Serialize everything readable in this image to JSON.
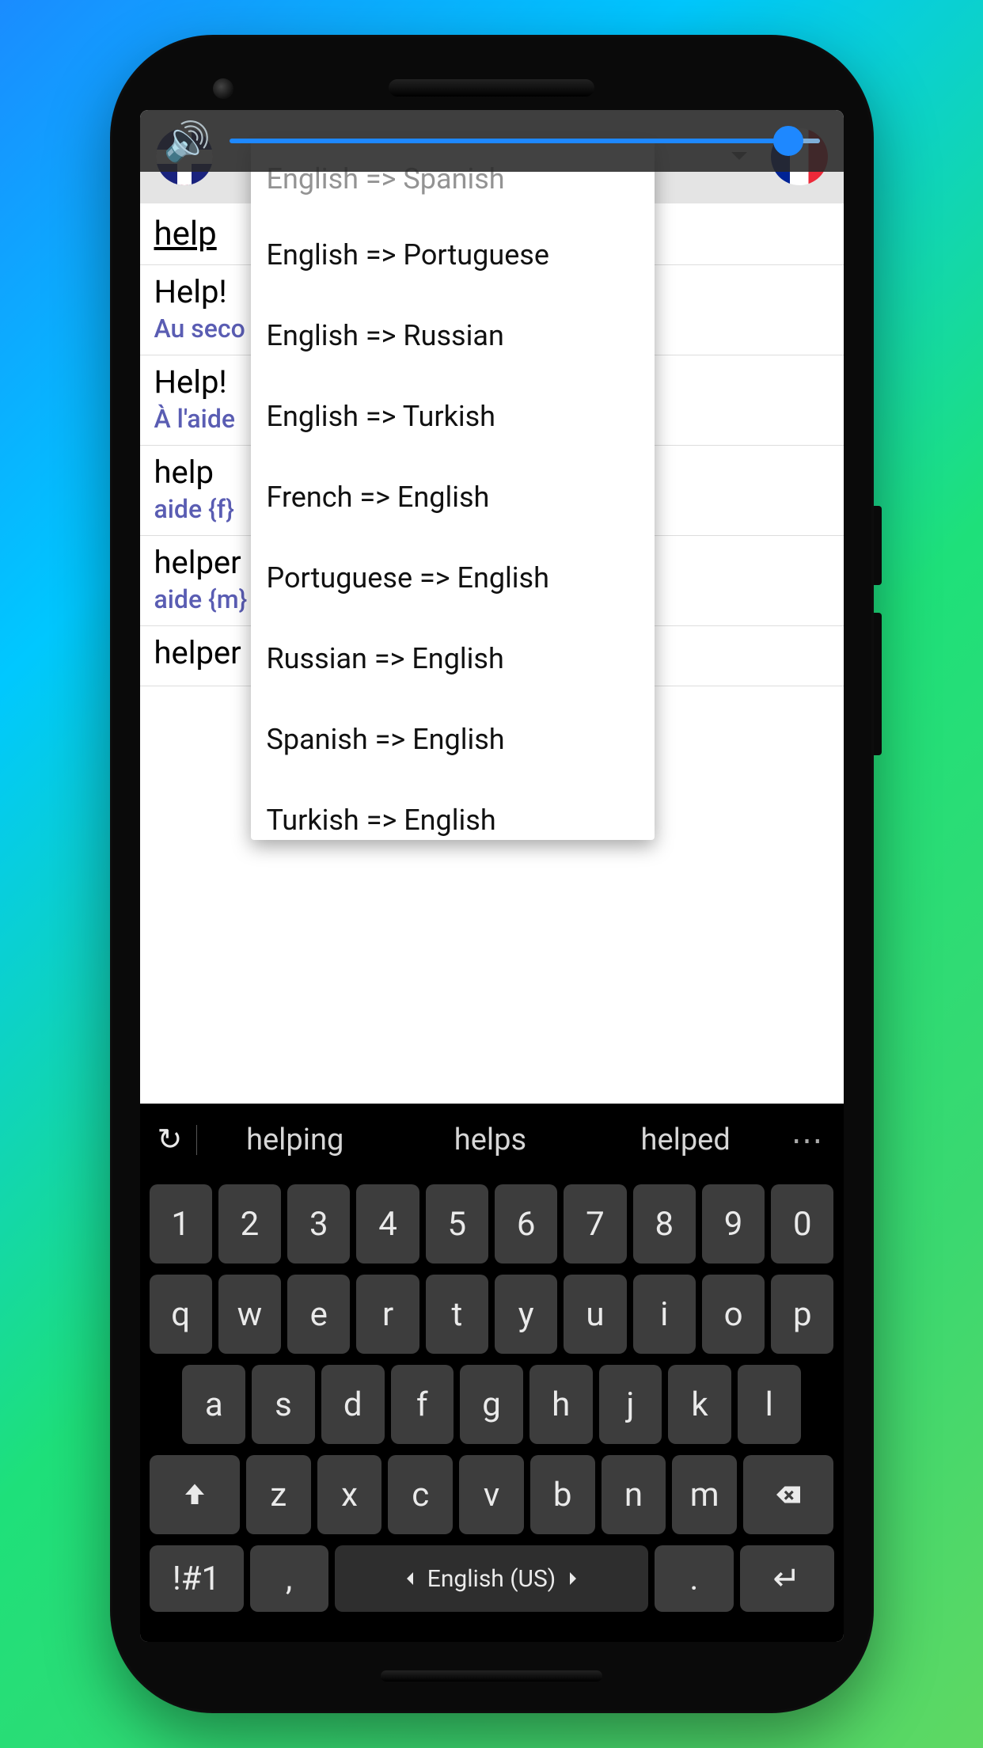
{
  "volume": {
    "icon": "🔊",
    "level_percent": 92
  },
  "header": {
    "source_flag": "uk",
    "target_flag": "fr",
    "selected_pair": "English => Spanish"
  },
  "dropdown": {
    "items": [
      "English => Spanish",
      "English => Portuguese",
      "English => Russian",
      "English => Turkish",
      "French => English",
      "Portuguese => English",
      "Russian => English",
      "Spanish => English",
      "Turkish => English"
    ]
  },
  "search": {
    "value": "help"
  },
  "entries": [
    {
      "src": "Help!",
      "dst": "Au seco"
    },
    {
      "src": "Help!",
      "dst": "À l'aide"
    },
    {
      "src": "help",
      "dst": "aide {f}"
    },
    {
      "src": "helper",
      "dst": "aide {m}"
    },
    {
      "src": "helper",
      "dst": ""
    }
  ],
  "keyboard": {
    "suggestions": [
      "helping",
      "helps",
      "helped"
    ],
    "cycle_icon": "↻",
    "more_icon": "⋯",
    "rows": {
      "num": [
        "1",
        "2",
        "3",
        "4",
        "5",
        "6",
        "7",
        "8",
        "9",
        "0"
      ],
      "r2": [
        "q",
        "w",
        "e",
        "r",
        "t",
        "y",
        "u",
        "i",
        "o",
        "p"
      ],
      "r3": [
        "a",
        "s",
        "d",
        "f",
        "g",
        "h",
        "j",
        "k",
        "l"
      ],
      "r4_mid": [
        "z",
        "x",
        "c",
        "v",
        "b",
        "n",
        "m"
      ],
      "sym": "!#1",
      "comma": ",",
      "space": "English (US)",
      "period": ".",
      "enter": "↵"
    }
  }
}
